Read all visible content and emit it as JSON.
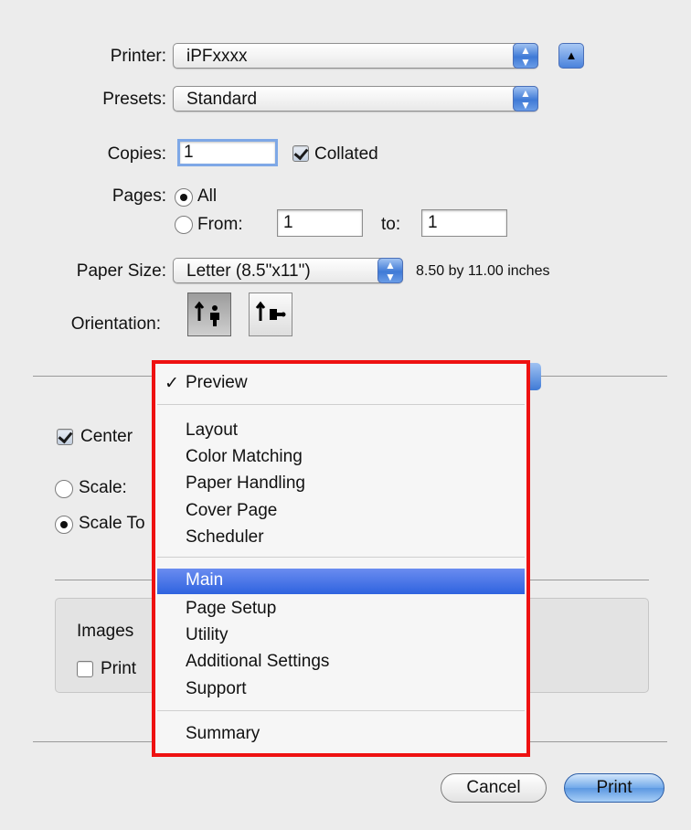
{
  "printer": {
    "label": "Printer:",
    "value": "iPFxxxx"
  },
  "presets": {
    "label": "Presets:",
    "value": "Standard"
  },
  "copies": {
    "label": "Copies:",
    "value": "1",
    "collated_label": "Collated",
    "collated_checked": true
  },
  "pages": {
    "label": "Pages:",
    "all_label": "All",
    "from_label": "From:",
    "from_value": "1",
    "to_label": "to:",
    "to_value": "1"
  },
  "paper_size": {
    "label": "Paper Size:",
    "value": "Letter (8.5\"x11\")",
    "dimensions": "8.50 by 11.00 inches"
  },
  "orientation": {
    "label": "Orientation:",
    "selected": "portrait"
  },
  "behind": {
    "center_label": "Center",
    "scale_label": "Scale:",
    "scale_to_label": "Scale To",
    "images_label": "Images",
    "print_label": "Print"
  },
  "menu": {
    "checked_item": "Preview",
    "group1": [
      "Layout",
      "Color Matching",
      "Paper Handling",
      "Cover Page",
      "Scheduler"
    ],
    "highlighted": "Main",
    "group2": [
      "Page Setup",
      "Utility",
      "Additional Settings",
      "Support"
    ],
    "group3": [
      "Summary"
    ]
  },
  "buttons": {
    "cancel": "Cancel",
    "print": "Print"
  },
  "colors": {
    "highlight": "#3b6ce3",
    "callout_border": "#ee1111",
    "default_button": "#5b97e1"
  }
}
